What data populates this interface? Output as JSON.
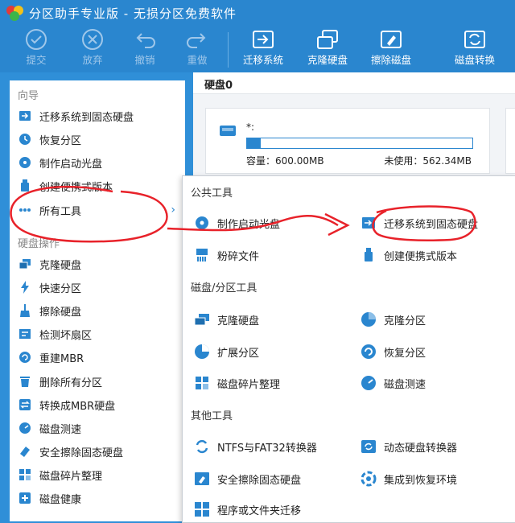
{
  "app": {
    "title": "分区助手专业版 - 无损分区免费软件"
  },
  "toolbar": {
    "submit": "提交",
    "discard": "放弃",
    "undo": "撤销",
    "redo": "重做",
    "migrate": "迁移系统",
    "clone": "克隆硬盘",
    "wipe": "擦除磁盘",
    "convert": "磁盘转换"
  },
  "sidebar": {
    "wizard_title": "向导",
    "wizard": [
      {
        "label": "迁移系统到固态硬盘",
        "icon": "ssd-migrate-icon"
      },
      {
        "label": "恢复分区",
        "icon": "recover-icon"
      },
      {
        "label": "制作启动光盘",
        "icon": "boot-disc-icon"
      },
      {
        "label": "创建便携式版本",
        "icon": "usb-icon"
      },
      {
        "label": "所有工具",
        "icon": "more-icon"
      }
    ],
    "disk_ops_title": "硬盘操作",
    "disk_ops": [
      {
        "label": "克隆硬盘",
        "icon": "clone-disk-icon"
      },
      {
        "label": "快速分区",
        "icon": "lightning-icon"
      },
      {
        "label": "擦除硬盘",
        "icon": "broom-icon"
      },
      {
        "label": "检测坏扇区",
        "icon": "scan-icon"
      },
      {
        "label": "重建MBR",
        "icon": "rebuild-icon"
      },
      {
        "label": "删除所有分区",
        "icon": "delete-icon"
      },
      {
        "label": "转换成MBR硬盘",
        "icon": "convert-icon"
      },
      {
        "label": "磁盘测速",
        "icon": "speed-icon"
      },
      {
        "label": "安全擦除固态硬盘",
        "icon": "eraser-icon"
      },
      {
        "label": "磁盘碎片整理",
        "icon": "defrag-icon"
      },
      {
        "label": "磁盘健康",
        "icon": "health-icon"
      }
    ]
  },
  "main": {
    "disk_label": "硬盘0",
    "partition": {
      "name": "*:",
      "used_fraction": 0.06,
      "capacity": "容量：600.00MB",
      "free": "未使用：562.34MB"
    }
  },
  "popup": {
    "public_title": "公共工具",
    "public": [
      {
        "label": "制作启动光盘",
        "icon": "boot-disc-icon"
      },
      {
        "label": "迁移系统到固态硬盘",
        "icon": "ssd-migrate-icon"
      },
      {
        "label": "粉碎文件",
        "icon": "shred-icon"
      },
      {
        "label": "创建便携式版本",
        "icon": "usb-icon"
      }
    ],
    "disk_title": "磁盘/分区工具",
    "disk": [
      {
        "label": "克隆硬盘",
        "icon": "clone-disk-icon"
      },
      {
        "label": "克隆分区",
        "icon": "clone-partition-icon"
      },
      {
        "label": "扩展分区",
        "icon": "extend-icon"
      },
      {
        "label": "恢复分区",
        "icon": "recover-icon"
      },
      {
        "label": "磁盘碎片整理",
        "icon": "defrag-icon"
      },
      {
        "label": "磁盘测速",
        "icon": "speed-icon"
      }
    ],
    "other_title": "其他工具",
    "other": [
      {
        "label": "NTFS与FAT32转换器",
        "icon": "ntfs-fat-icon"
      },
      {
        "label": "动态硬盘转换器",
        "icon": "dynamic-disk-icon"
      },
      {
        "label": "安全擦除固态硬盘",
        "icon": "eraser-icon"
      },
      {
        "label": "集成到恢复环境",
        "icon": "integrate-icon"
      },
      {
        "label": "程序或文件夹迁移",
        "icon": "app-move-icon"
      }
    ]
  },
  "colors": {
    "accent": "#2a86cf",
    "annotation": "#e8222a"
  }
}
